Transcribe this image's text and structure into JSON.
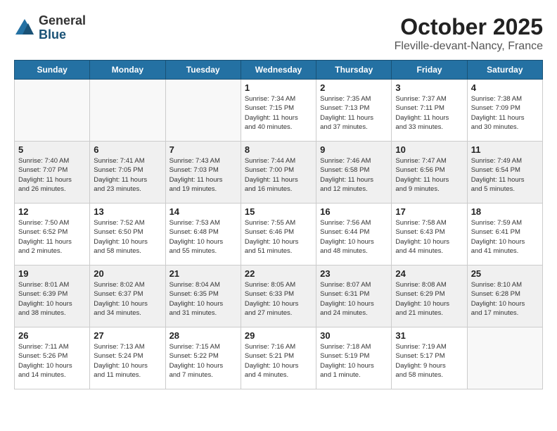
{
  "logo": {
    "general": "General",
    "blue": "Blue"
  },
  "title": "October 2025",
  "location": "Fleville-devant-Nancy, France",
  "days_header": [
    "Sunday",
    "Monday",
    "Tuesday",
    "Wednesday",
    "Thursday",
    "Friday",
    "Saturday"
  ],
  "weeks": [
    [
      {
        "day": "",
        "info": "",
        "empty": true
      },
      {
        "day": "",
        "info": "",
        "empty": true
      },
      {
        "day": "",
        "info": "",
        "empty": true
      },
      {
        "day": "1",
        "info": "Sunrise: 7:34 AM\nSunset: 7:15 PM\nDaylight: 11 hours\nand 40 minutes."
      },
      {
        "day": "2",
        "info": "Sunrise: 7:35 AM\nSunset: 7:13 PM\nDaylight: 11 hours\nand 37 minutes."
      },
      {
        "day": "3",
        "info": "Sunrise: 7:37 AM\nSunset: 7:11 PM\nDaylight: 11 hours\nand 33 minutes."
      },
      {
        "day": "4",
        "info": "Sunrise: 7:38 AM\nSunset: 7:09 PM\nDaylight: 11 hours\nand 30 minutes."
      }
    ],
    [
      {
        "day": "5",
        "info": "Sunrise: 7:40 AM\nSunset: 7:07 PM\nDaylight: 11 hours\nand 26 minutes."
      },
      {
        "day": "6",
        "info": "Sunrise: 7:41 AM\nSunset: 7:05 PM\nDaylight: 11 hours\nand 23 minutes."
      },
      {
        "day": "7",
        "info": "Sunrise: 7:43 AM\nSunset: 7:03 PM\nDaylight: 11 hours\nand 19 minutes."
      },
      {
        "day": "8",
        "info": "Sunrise: 7:44 AM\nSunset: 7:00 PM\nDaylight: 11 hours\nand 16 minutes."
      },
      {
        "day": "9",
        "info": "Sunrise: 7:46 AM\nSunset: 6:58 PM\nDaylight: 11 hours\nand 12 minutes."
      },
      {
        "day": "10",
        "info": "Sunrise: 7:47 AM\nSunset: 6:56 PM\nDaylight: 11 hours\nand 9 minutes."
      },
      {
        "day": "11",
        "info": "Sunrise: 7:49 AM\nSunset: 6:54 PM\nDaylight: 11 hours\nand 5 minutes."
      }
    ],
    [
      {
        "day": "12",
        "info": "Sunrise: 7:50 AM\nSunset: 6:52 PM\nDaylight: 11 hours\nand 2 minutes."
      },
      {
        "day": "13",
        "info": "Sunrise: 7:52 AM\nSunset: 6:50 PM\nDaylight: 10 hours\nand 58 minutes."
      },
      {
        "day": "14",
        "info": "Sunrise: 7:53 AM\nSunset: 6:48 PM\nDaylight: 10 hours\nand 55 minutes."
      },
      {
        "day": "15",
        "info": "Sunrise: 7:55 AM\nSunset: 6:46 PM\nDaylight: 10 hours\nand 51 minutes."
      },
      {
        "day": "16",
        "info": "Sunrise: 7:56 AM\nSunset: 6:44 PM\nDaylight: 10 hours\nand 48 minutes."
      },
      {
        "day": "17",
        "info": "Sunrise: 7:58 AM\nSunset: 6:43 PM\nDaylight: 10 hours\nand 44 minutes."
      },
      {
        "day": "18",
        "info": "Sunrise: 7:59 AM\nSunset: 6:41 PM\nDaylight: 10 hours\nand 41 minutes."
      }
    ],
    [
      {
        "day": "19",
        "info": "Sunrise: 8:01 AM\nSunset: 6:39 PM\nDaylight: 10 hours\nand 38 minutes."
      },
      {
        "day": "20",
        "info": "Sunrise: 8:02 AM\nSunset: 6:37 PM\nDaylight: 10 hours\nand 34 minutes."
      },
      {
        "day": "21",
        "info": "Sunrise: 8:04 AM\nSunset: 6:35 PM\nDaylight: 10 hours\nand 31 minutes."
      },
      {
        "day": "22",
        "info": "Sunrise: 8:05 AM\nSunset: 6:33 PM\nDaylight: 10 hours\nand 27 minutes."
      },
      {
        "day": "23",
        "info": "Sunrise: 8:07 AM\nSunset: 6:31 PM\nDaylight: 10 hours\nand 24 minutes."
      },
      {
        "day": "24",
        "info": "Sunrise: 8:08 AM\nSunset: 6:29 PM\nDaylight: 10 hours\nand 21 minutes."
      },
      {
        "day": "25",
        "info": "Sunrise: 8:10 AM\nSunset: 6:28 PM\nDaylight: 10 hours\nand 17 minutes."
      }
    ],
    [
      {
        "day": "26",
        "info": "Sunrise: 7:11 AM\nSunset: 5:26 PM\nDaylight: 10 hours\nand 14 minutes."
      },
      {
        "day": "27",
        "info": "Sunrise: 7:13 AM\nSunset: 5:24 PM\nDaylight: 10 hours\nand 11 minutes."
      },
      {
        "day": "28",
        "info": "Sunrise: 7:15 AM\nSunset: 5:22 PM\nDaylight: 10 hours\nand 7 minutes."
      },
      {
        "day": "29",
        "info": "Sunrise: 7:16 AM\nSunset: 5:21 PM\nDaylight: 10 hours\nand 4 minutes."
      },
      {
        "day": "30",
        "info": "Sunrise: 7:18 AM\nSunset: 5:19 PM\nDaylight: 10 hours\nand 1 minute."
      },
      {
        "day": "31",
        "info": "Sunrise: 7:19 AM\nSunset: 5:17 PM\nDaylight: 9 hours\nand 58 minutes."
      },
      {
        "day": "",
        "info": "",
        "empty": true
      }
    ]
  ]
}
